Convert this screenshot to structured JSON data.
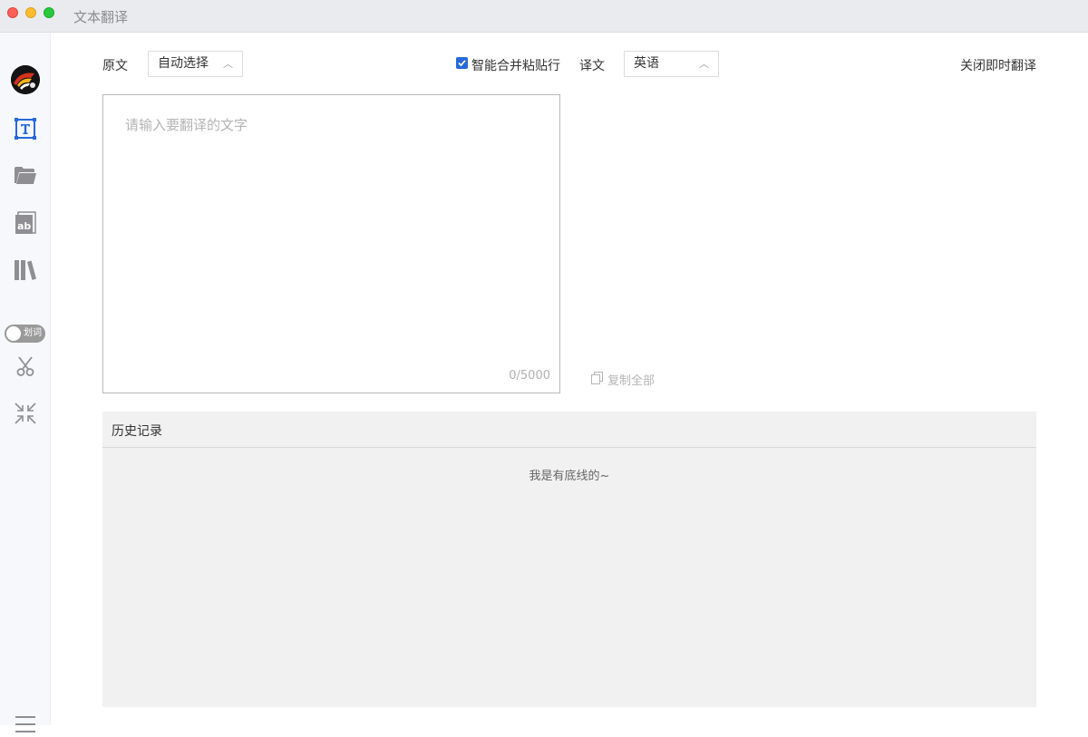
{
  "window": {
    "title": "文本翻译"
  },
  "sidebar": {
    "items": [
      {
        "name": "avatar"
      },
      {
        "name": "text-translate-icon",
        "active": true
      },
      {
        "name": "folder-icon"
      },
      {
        "name": "ab-document-icon"
      },
      {
        "name": "library-icon"
      },
      {
        "name": "scissors-icon"
      },
      {
        "name": "shrink-icon"
      },
      {
        "name": "menu-icon"
      }
    ],
    "toggle_label": "划词",
    "toggle_on": false
  },
  "toolbar": {
    "source_label": "原文",
    "source_language": "自动选择",
    "smart_merge_label": "智能合并粘贴行",
    "smart_merge_checked": true,
    "target_label": "译文",
    "target_language": "英语",
    "instant_translate_label": "关闭即时翻译"
  },
  "source": {
    "placeholder": "请输入要翻译的文字",
    "value": "",
    "counter": "0/5000"
  },
  "result": {
    "copy_all_label": "复制全部"
  },
  "history": {
    "title": "历史记录",
    "empty_text": "我是有底线的~"
  },
  "colors": {
    "accent": "#2769d9",
    "titlebar": "#e9ebee",
    "sidebar": "#f6f8fc",
    "history_bg": "#f1f1f1"
  }
}
